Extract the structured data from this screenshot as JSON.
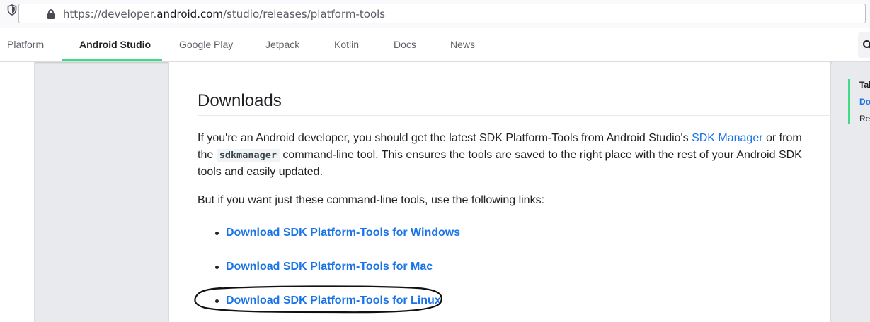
{
  "browser": {
    "url_prefix": "https://developer.",
    "url_domain": "android.com",
    "url_path": "/studio/releases/platform-tools"
  },
  "nav": {
    "tabs": [
      {
        "label": "Platform",
        "active": false
      },
      {
        "label": "Android Studio",
        "active": true
      },
      {
        "label": "Google Play",
        "active": false
      },
      {
        "label": "Jetpack",
        "active": false
      },
      {
        "label": "Kotlin",
        "active": false
      },
      {
        "label": "Docs",
        "active": false
      },
      {
        "label": "News",
        "active": false
      }
    ],
    "accent_color": "#3ddc84"
  },
  "main": {
    "heading": "Downloads",
    "intro_part1": "If you're an Android developer, you should get the latest SDK Platform-Tools from Android Studio's ",
    "intro_link": "SDK Manager",
    "intro_part2": " or from the ",
    "intro_code": "sdkmanager",
    "intro_part3": " command-line tool. This ensures the tools are saved to the right place with the rest of your Android SDK tools and easily updated.",
    "links_intro": "But if you want just these command-line tools, use the following links:",
    "downloads": [
      "Download SDK Platform-Tools for Windows",
      "Download SDK Platform-Tools for Mac",
      "Download SDK Platform-Tools for Linux"
    ],
    "link_color": "#1a73e8"
  },
  "toc": {
    "items": [
      "Tal",
      "Do",
      "Re"
    ]
  }
}
